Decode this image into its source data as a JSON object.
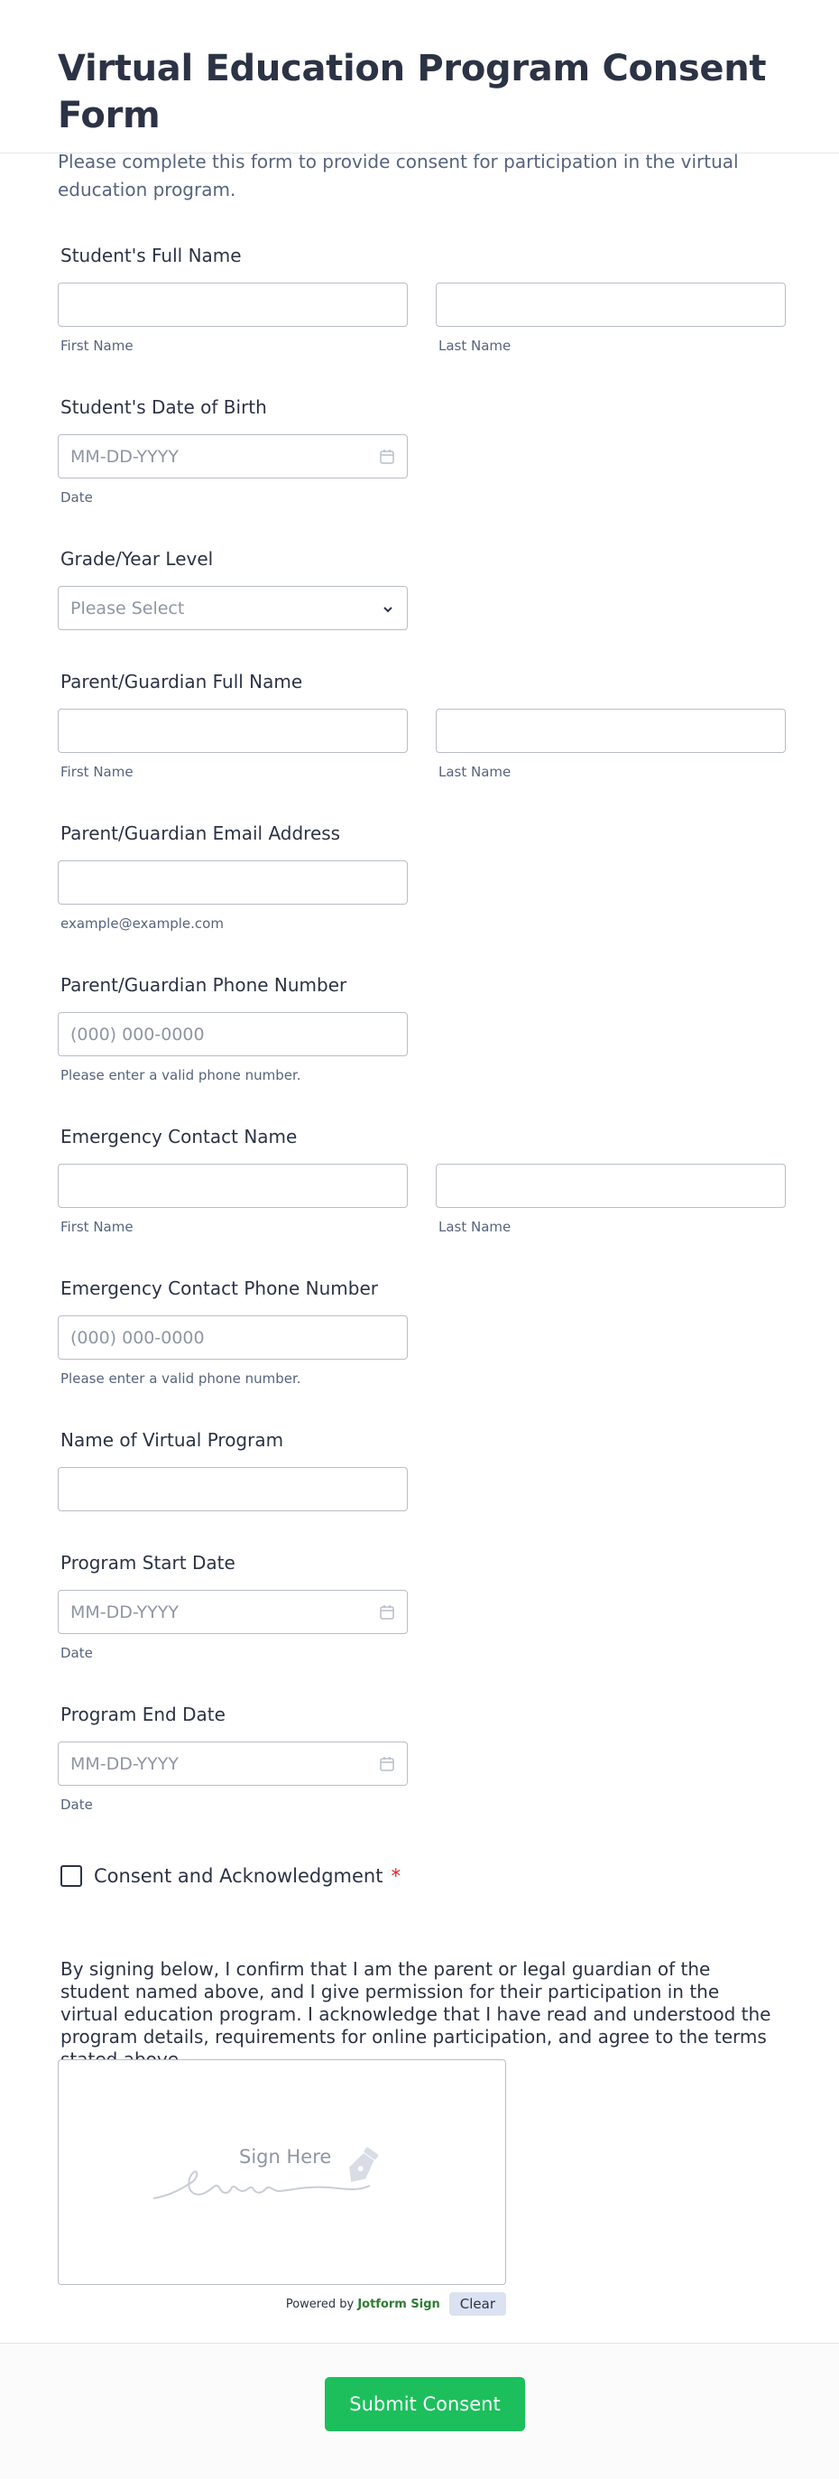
{
  "header": {
    "title": "Virtual Education Program Consent Form",
    "subtitle": "Please complete this form to provide consent for participation in the virtual education program."
  },
  "fields": {
    "student_name": {
      "label": "Student's Full Name",
      "first": "First Name",
      "last": "Last Name"
    },
    "student_dob": {
      "label": "Student's Date of Birth",
      "placeholder": "MM-DD-YYYY",
      "sublabel": "Date"
    },
    "grade": {
      "label": "Grade/Year Level",
      "placeholder": "Please Select"
    },
    "guardian_name": {
      "label": "Parent/Guardian Full Name",
      "first": "First Name",
      "last": "Last Name"
    },
    "guardian_email": {
      "label": "Parent/Guardian Email Address",
      "sublabel": "example@example.com"
    },
    "guardian_phone": {
      "label": "Parent/Guardian Phone Number",
      "placeholder": "(000) 000-0000",
      "sublabel": "Please enter a valid phone number."
    },
    "emergency_name": {
      "label": "Emergency Contact Name",
      "first": "First Name",
      "last": "Last Name"
    },
    "emergency_phone": {
      "label": "Emergency Contact Phone Number",
      "placeholder": "(000) 000-0000",
      "sublabel": "Please enter a valid phone number."
    },
    "program_name": {
      "label": "Name of Virtual Program"
    },
    "start_date": {
      "label": "Program Start Date",
      "placeholder": "MM-DD-YYYY",
      "sublabel": "Date"
    },
    "end_date": {
      "label": "Program End Date",
      "placeholder": "MM-DD-YYYY",
      "sublabel": "Date"
    }
  },
  "consent": {
    "label": "Consent and Acknowledgment",
    "required_mark": "*",
    "statement": "By signing below, I confirm that I am the parent or legal guardian of the student named above, and I give permission for their participation in the virtual education program. I acknowledge that I have read and understood the program details, requirements for online participation, and agree to the terms stated above."
  },
  "signature": {
    "hint": "Sign Here",
    "powered_prefix": "Powered by ",
    "powered_brand": "Jotform Sign",
    "clear_label": "Clear"
  },
  "submit": {
    "label": "Submit Consent"
  },
  "colors": {
    "accent": "#1cbf5c",
    "border": "#b8bdc9",
    "text": "#2c3345",
    "muted": "#57647e",
    "required": "#e02020"
  }
}
